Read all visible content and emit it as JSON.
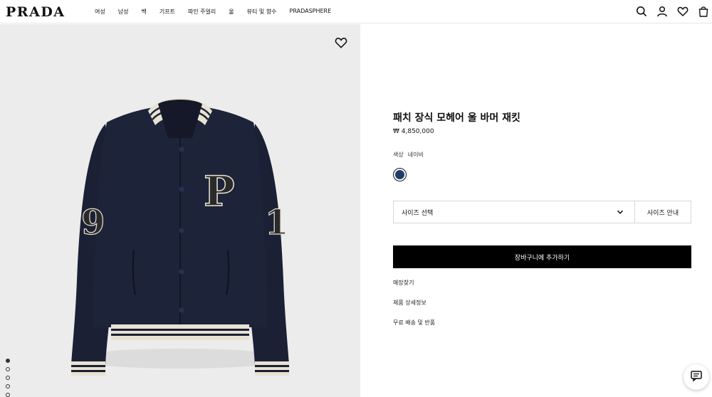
{
  "header": {
    "logo": "PRADA",
    "nav": [
      "여성",
      "남성",
      "백",
      "기프트",
      "파인 주얼리",
      "울",
      "뷰티 및 향수",
      "PRADASPHERE"
    ],
    "icons": [
      "search-icon",
      "account-icon",
      "wishlist-icon",
      "bag-icon"
    ]
  },
  "gallery": {
    "image_subject": "navy bomber jacket with P patch and striped ribbed trims",
    "dots_count": 5,
    "active_dot": 0
  },
  "product": {
    "title": "패치 장식 모헤어 울 바머 재킷",
    "price": "₩ 4,850,000",
    "color_label": "색상",
    "color_value": "네이비",
    "swatch_color": "#1f3d6b",
    "size_placeholder": "사이즈 선택",
    "size_guide": "사이즈 안내",
    "cart_button": "장바구니에 추가하기",
    "links": [
      "매장찾기",
      "제품 상세정보",
      "무료 배송 및 반품"
    ]
  },
  "colors": {
    "accent": "#000000",
    "background_image": "#ececec",
    "jacket": "#1b2035",
    "trim_cream": "#e8e2d2"
  }
}
